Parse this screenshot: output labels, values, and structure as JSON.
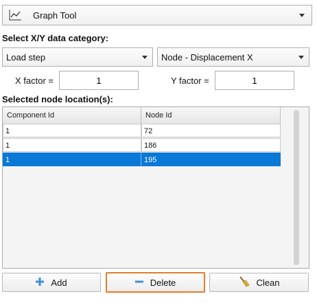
{
  "tool_selector": {
    "label": "Graph Tool",
    "icon": "line-chart-icon"
  },
  "section_xy": {
    "title": "Select X/Y data category:"
  },
  "x_category": {
    "value": "Load step"
  },
  "y_category": {
    "value": "Node - Displacement X"
  },
  "x_factor": {
    "label": "X factor =",
    "value": "1"
  },
  "y_factor": {
    "label": "Y factor =",
    "value": "1"
  },
  "section_nodes": {
    "title": "Selected node location(s):"
  },
  "table": {
    "columns": [
      "Component Id",
      "Node Id"
    ],
    "rows": [
      [
        "1",
        "72"
      ],
      [
        "1",
        "186"
      ],
      [
        "1",
        "195"
      ]
    ],
    "selected_row": 3
  },
  "buttons": {
    "add": {
      "label": "Add",
      "icon": "plus-icon"
    },
    "delete": {
      "label": "Delete",
      "icon": "minus-icon"
    },
    "clean": {
      "label": "Clean",
      "icon": "broom-icon"
    }
  },
  "colors": {
    "selection": "#0a78d7",
    "focus_border": "#e07e2a",
    "plus_icon": "#3b8ed8"
  }
}
